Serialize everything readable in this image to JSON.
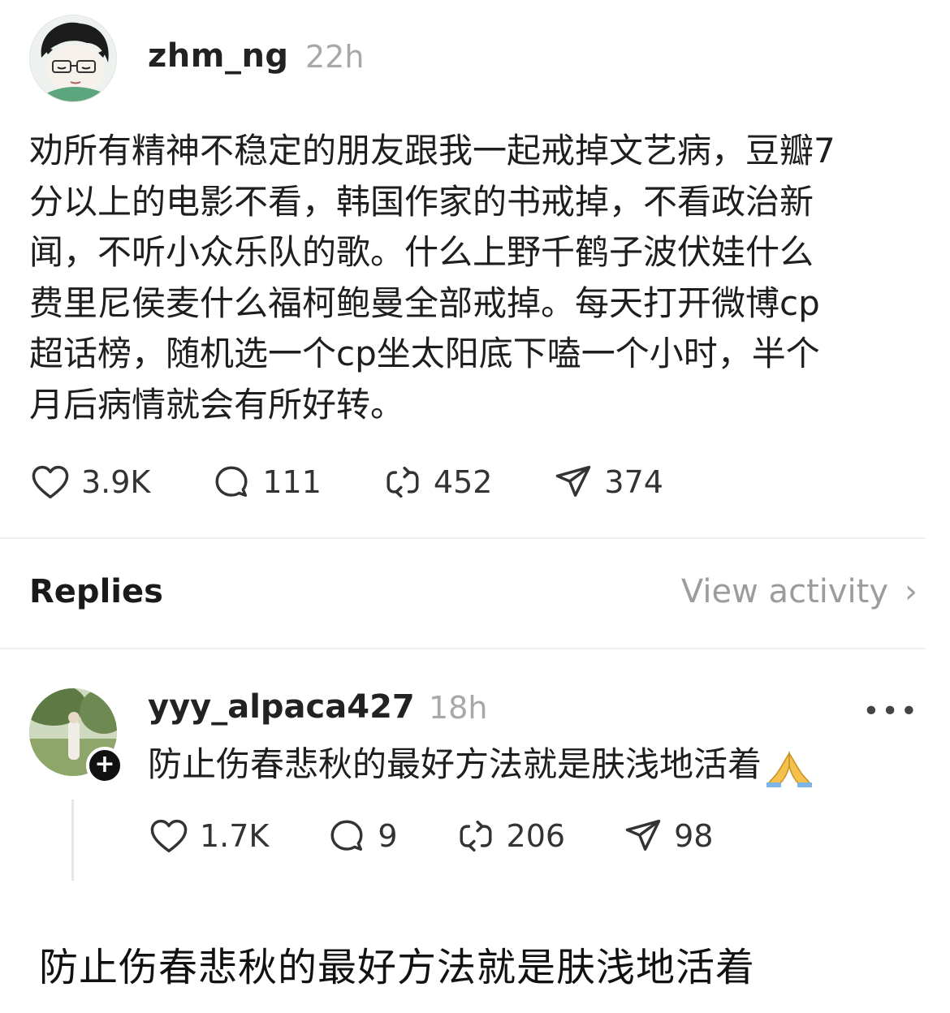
{
  "post": {
    "username": "zhm_ng",
    "time": "22h",
    "body": "劝所有精神不稳定的朋友跟我一起戒掉文艺病，豆瓣7\n分以上的电影不看，韩国作家的书戒掉，不看政治新\n闻，不听小众乐队的歌。什么上野千鹤子波伏娃什么\n费里尼侯麦什么福柯鲍曼全部戒掉。每天打开微博cp\n超话榜，随机选一个cp坐太阳底下嗑一个小时，半个\n月后病情就会有所好转。",
    "likes": "3.9K",
    "comments": "111",
    "reposts": "452",
    "shares": "374"
  },
  "replies_header": {
    "label": "Replies",
    "view_activity": "View activity",
    "chevron": "›"
  },
  "reply": {
    "username": "yyy_alpaca427",
    "time": "18h",
    "more": "•••",
    "body": "防止伤春悲秋的最好方法就是肤浅地活着",
    "emoji": "folded-hands",
    "likes": "1.7K",
    "comments": "9",
    "reposts": "206",
    "shares": "98",
    "follow_symbol": "+"
  },
  "caption": "防止伤春悲秋的最好方法就是肤浅地活着"
}
